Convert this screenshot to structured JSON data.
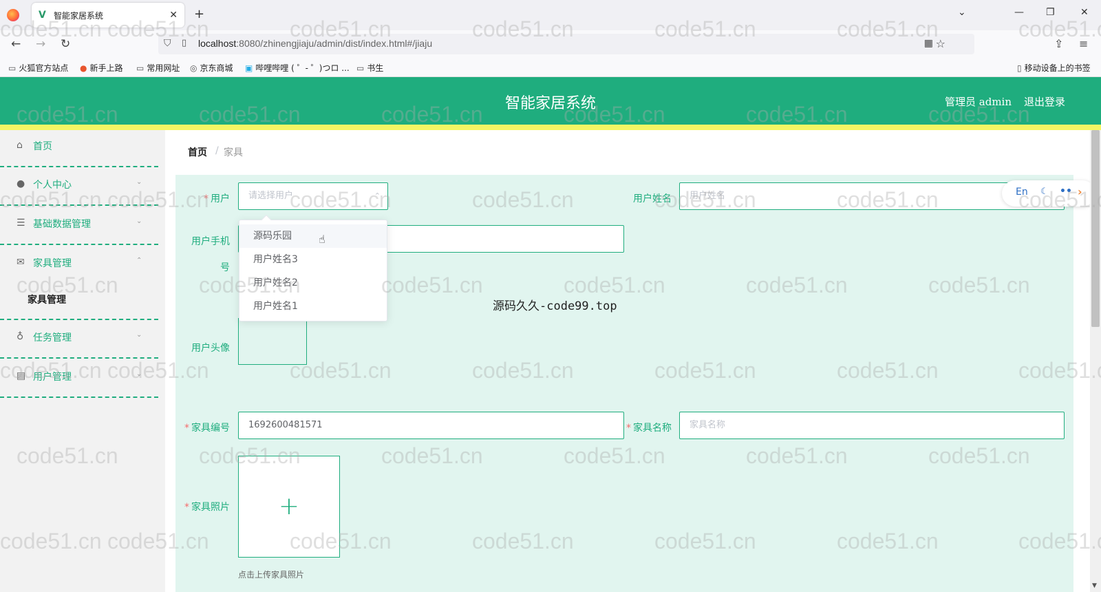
{
  "browser": {
    "tab_title": "智能家居系统",
    "tab_favicon": "V",
    "url_host": "localhost",
    "url_rest": ":8080/zhinengjiaju/admin/dist/index.html#/jiaju",
    "bookmarks": [
      "火狐官方站点",
      "新手上路",
      "常用网址",
      "京东商城",
      "哔哩哔哩 ( ゜- ゜)つロ ...",
      "书生"
    ],
    "mobile_bookmarks": "移动设备上的书签"
  },
  "header": {
    "title": "智能家居系统",
    "admin_label": "管理员 admin",
    "logout": "退出登录",
    "brand_color": "#1fad7e"
  },
  "sidebar": {
    "items": [
      {
        "label": "首页",
        "icon": "home-icon"
      },
      {
        "label": "个人中心",
        "icon": "user-icon"
      },
      {
        "label": "基础数据管理",
        "icon": "sliders-icon"
      },
      {
        "label": "家具管理",
        "icon": "mail-icon"
      },
      {
        "label": "任务管理",
        "icon": "mic-icon"
      },
      {
        "label": "用户管理",
        "icon": "card-icon"
      }
    ],
    "sub_item": "家具管理"
  },
  "breadcrumb": {
    "home": "首页",
    "separator": "/",
    "current": "家具"
  },
  "form": {
    "user_label": "用户",
    "user_placeholder": "请选择用户",
    "user_name_label": "用户姓名",
    "user_name_placeholder": "用户姓名",
    "user_phone_label_1": "用户手机",
    "user_phone_label_2": "号",
    "user_avatar_label": "用户头像",
    "furniture_no_label": "家具编号",
    "furniture_no_value": "1692600481571",
    "furniture_name_label": "家具名称",
    "furniture_name_placeholder": "家具名称",
    "furniture_photo_label": "家具照片",
    "upload_tip": "点击上传家具照片"
  },
  "dropdown": {
    "options": [
      "源码乐园",
      "用户姓名3",
      "用户姓名2",
      "用户姓名1"
    ]
  },
  "center_watermark": "源码久久-code99.top",
  "watermark": "code51.cn",
  "widget": {
    "lang": "En"
  }
}
